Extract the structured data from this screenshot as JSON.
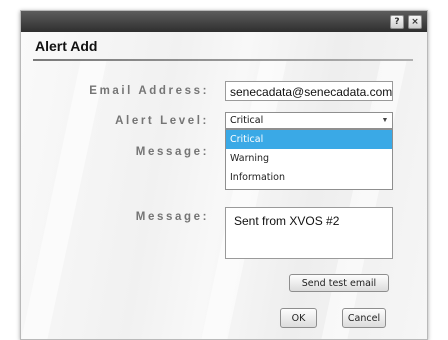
{
  "window": {
    "help_button": "?",
    "close_button": "×"
  },
  "dialog": {
    "title": "Alert Add"
  },
  "form": {
    "email_label": "Email Address:",
    "email_value": "senecadata@senecadata.com",
    "alert_level_label": "Alert Level:",
    "alert_level_value": "Critical",
    "alert_level_options": [
      "Critical",
      "Warning",
      "Information"
    ],
    "message_label_hidden": "Message:",
    "message_label": "Message:",
    "message_value": "Sent from XVOS #2"
  },
  "buttons": {
    "send_test": "Send test email",
    "ok": "OK",
    "cancel": "Cancel"
  },
  "icons": {
    "dropdown": "chevron-down-icon",
    "help": "help-icon",
    "close": "close-icon"
  },
  "colors": {
    "selection": "#3aa9e6",
    "titlebar": "#3b3b3b"
  }
}
